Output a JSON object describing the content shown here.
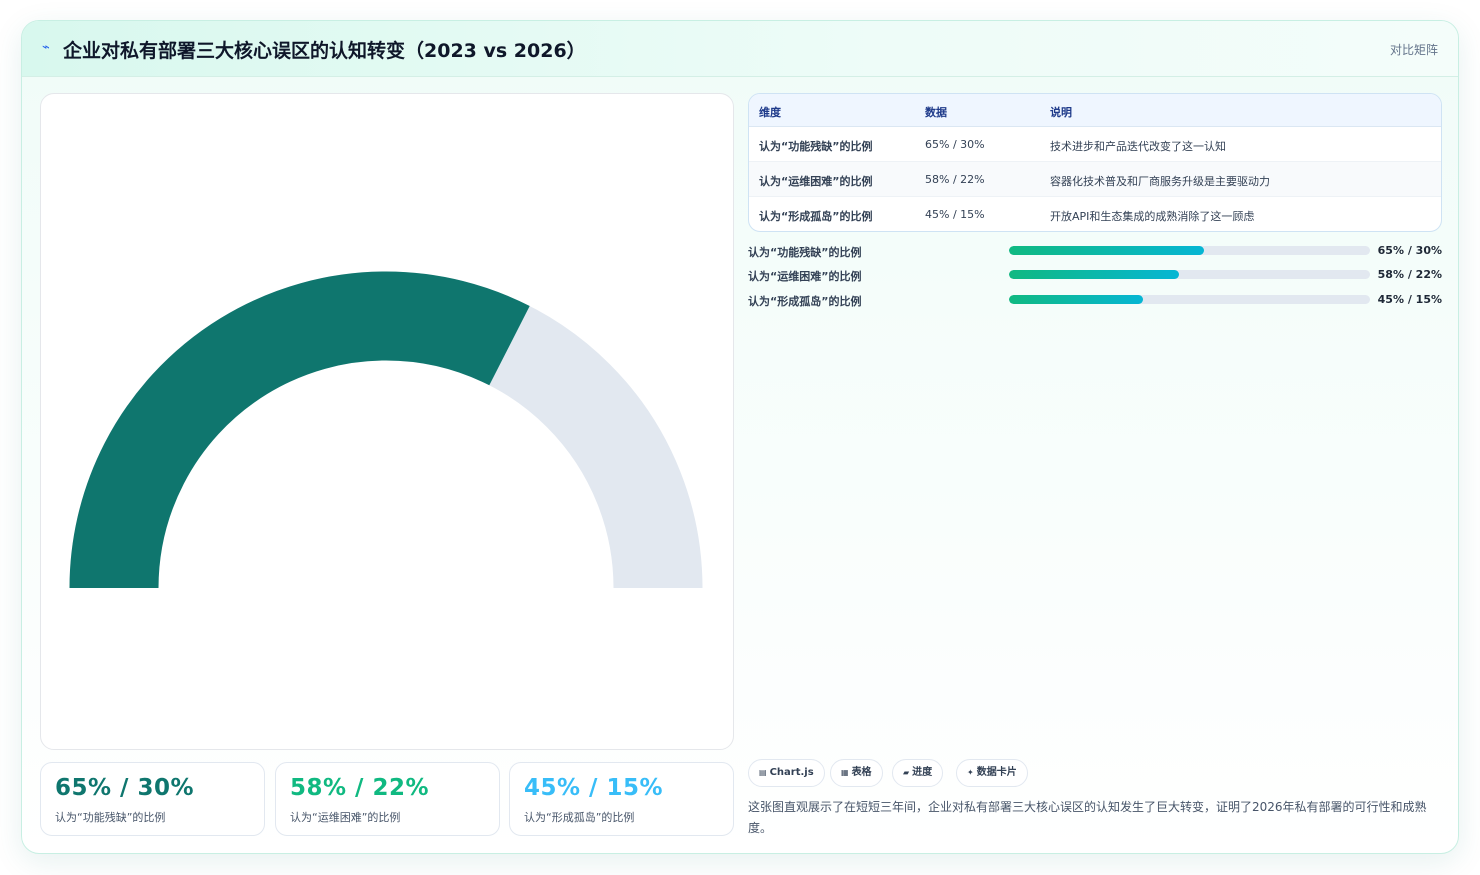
{
  "header": {
    "icon": "sparkline-icon",
    "title": "企业对私有部署三大核心误区的认知转变（2023 vs 2026）",
    "tag": "对比矩阵"
  },
  "colors": {
    "gauge_fill": "#0f766e",
    "gauge_track": "#e2e8f0",
    "kpi1": "#0f766e",
    "kpi2": "#10b981",
    "kpi3": "#38bdf8",
    "bar_from": "#10b981",
    "bar_to": "#06b6d4"
  },
  "gauge": {
    "value_fraction": 0.65
  },
  "kpis": [
    {
      "value": "65% / 30%",
      "label": "认为“功能残缺”的比例"
    },
    {
      "value": "58% / 22%",
      "label": "认为“运维困难”的比例"
    },
    {
      "value": "45% / 15%",
      "label": "认为“形成孤岛”的比例"
    }
  ],
  "table": {
    "headers": [
      "维度",
      "数据",
      "说明"
    ],
    "rows": [
      {
        "dimension": "认为“功能残缺”的比例",
        "data": "65% / 30%",
        "note": "技术进步和产品迭代改变了这一认知"
      },
      {
        "dimension": "认为“运维困难”的比例",
        "data": "58% / 22%",
        "note": "容器化技术普及和厂商服务升级是主要驱动力"
      },
      {
        "dimension": "认为“形成孤岛”的比例",
        "data": "45% / 15%",
        "note": "开放API和生态集成的成熟消除了这一顾虑"
      }
    ]
  },
  "progress": [
    {
      "label": "认为“功能残缺”的比例",
      "value": "65% / 30%",
      "fraction": 0.54
    },
    {
      "label": "认为“运维困难”的比例",
      "value": "58% / 22%",
      "fraction": 0.47
    },
    {
      "label": "认为“形成孤岛”的比例",
      "value": "45% / 15%",
      "fraction": 0.37
    }
  ],
  "chips": [
    {
      "icon": "chart-icon",
      "glyph": "▤",
      "label": "Chart.js"
    },
    {
      "icon": "table-icon",
      "glyph": "▦",
      "label": "表格"
    },
    {
      "icon": "progress-icon",
      "glyph": "▰",
      "label": "进度"
    },
    {
      "icon": "sparkle-icon",
      "glyph": "✦",
      "label": "数据卡片"
    }
  ],
  "footnote": "这张图直观展示了在短短三年间，企业对私有部署三大核心误区的认知发生了巨大转变，证明了2026年私有部署的可行性和成熟度。"
}
